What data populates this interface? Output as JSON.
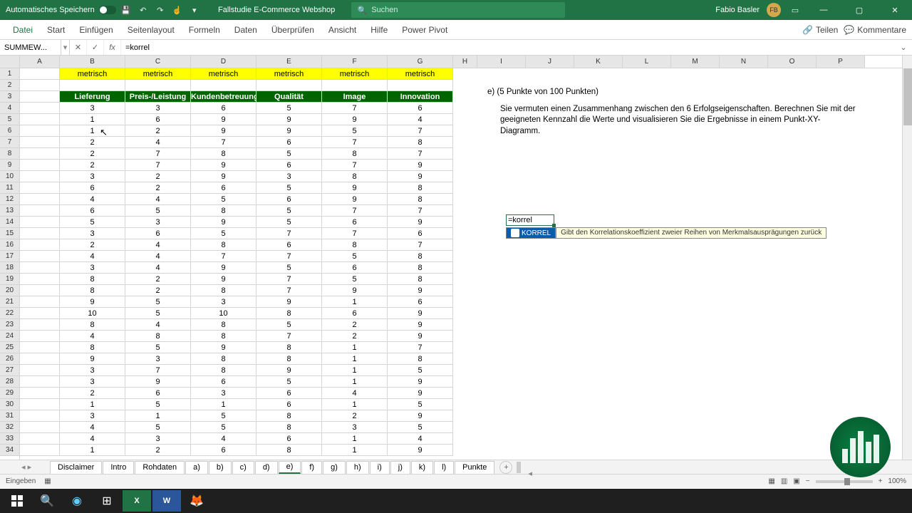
{
  "title_bar": {
    "autosave": "Automatisches Speichern",
    "doc_title": "Fallstudie E-Commerce Webshop",
    "search_placeholder": "Suchen",
    "user_name": "Fabio Basler",
    "user_initials": "FB"
  },
  "ribbon": {
    "tabs": [
      "Datei",
      "Start",
      "Einfügen",
      "Seitenlayout",
      "Formeln",
      "Daten",
      "Überprüfen",
      "Ansicht",
      "Hilfe",
      "Power Pivot"
    ],
    "share": "Teilen",
    "comments": "Kommentare"
  },
  "formula_bar": {
    "name_box": "SUMMEW...",
    "formula": "=korrel"
  },
  "columns": [
    "A",
    "B",
    "C",
    "D",
    "E",
    "F",
    "G",
    "H",
    "I",
    "J",
    "K",
    "L",
    "M",
    "N",
    "O",
    "P"
  ],
  "metrisch_label": "metrisch",
  "headers": [
    "Lieferung",
    "Preis-/Leistung",
    "Kundenbetreuung",
    "Qualität",
    "Image",
    "Innovation"
  ],
  "data_rows": [
    [
      3,
      3,
      6,
      5,
      7,
      6
    ],
    [
      1,
      6,
      9,
      9,
      9,
      4
    ],
    [
      1,
      2,
      9,
      9,
      5,
      7
    ],
    [
      2,
      4,
      7,
      6,
      7,
      8
    ],
    [
      2,
      7,
      8,
      5,
      8,
      7
    ],
    [
      2,
      7,
      9,
      6,
      7,
      9
    ],
    [
      3,
      2,
      9,
      3,
      8,
      9
    ],
    [
      6,
      2,
      6,
      5,
      9,
      8
    ],
    [
      4,
      4,
      5,
      6,
      9,
      8
    ],
    [
      6,
      5,
      8,
      5,
      7,
      7
    ],
    [
      5,
      3,
      9,
      5,
      6,
      9
    ],
    [
      3,
      6,
      5,
      7,
      7,
      6
    ],
    [
      2,
      4,
      8,
      6,
      8,
      7
    ],
    [
      4,
      4,
      7,
      7,
      5,
      8
    ],
    [
      3,
      4,
      9,
      5,
      6,
      8
    ],
    [
      8,
      2,
      9,
      7,
      5,
      8
    ],
    [
      8,
      2,
      8,
      7,
      9,
      9
    ],
    [
      9,
      5,
      3,
      9,
      1,
      6
    ],
    [
      10,
      5,
      10,
      8,
      6,
      9
    ],
    [
      8,
      4,
      8,
      5,
      2,
      9
    ],
    [
      4,
      8,
      8,
      7,
      2,
      9
    ],
    [
      8,
      5,
      9,
      8,
      1,
      7
    ],
    [
      9,
      3,
      8,
      8,
      1,
      8
    ],
    [
      3,
      7,
      8,
      9,
      1,
      5
    ],
    [
      3,
      9,
      6,
      5,
      1,
      9
    ],
    [
      2,
      6,
      3,
      6,
      4,
      9
    ],
    [
      1,
      5,
      1,
      6,
      1,
      5
    ],
    [
      3,
      1,
      5,
      8,
      2,
      9
    ],
    [
      4,
      5,
      5,
      8,
      3,
      5
    ],
    [
      4,
      3,
      4,
      6,
      1,
      4
    ],
    [
      1,
      2,
      6,
      8,
      1,
      9
    ]
  ],
  "task": {
    "heading": "e) (5 Punkte von 100 Punkten)",
    "body": "Sie vermuten einen Zusammenhang zwischen den 6 Erfolgseigenschaften. Berechnen Sie mit der geeigneten Kennzahl die Werte und visualisieren Sie die Ergebnisse in einem Punkt-XY-Diagramm."
  },
  "editing": {
    "value": "=korrel",
    "suggestion": "KORREL",
    "hint": "Gibt den Korrelationskoeffizient zweier Reihen von Merkmalsausprägungen zurück"
  },
  "sheets": [
    "Disclaimer",
    "Intro",
    "Rohdaten",
    "a)",
    "b)",
    "c)",
    "d)",
    "e)",
    "f)",
    "g)",
    "h)",
    "i)",
    "j)",
    "k)",
    "l)",
    "Punkte"
  ],
  "active_sheet": "e)",
  "status_bar": {
    "mode": "Eingeben",
    "zoom": "100%"
  },
  "add_sheet": "+",
  "win_icons": {
    "min": "—",
    "max": "▢",
    "close": "✕"
  }
}
